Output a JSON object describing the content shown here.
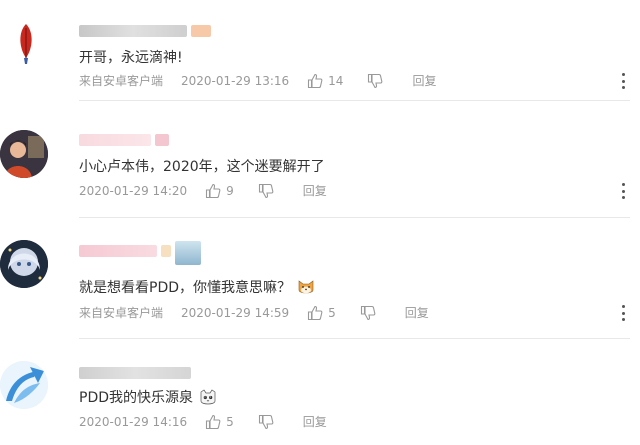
{
  "comments": [
    {
      "text": "开哥，永远滴神!",
      "source": "来自安卓客户端",
      "time": "2020-01-29 13:16",
      "likes": "14",
      "reply_label": "回复",
      "avatar": "red-feather-icon"
    },
    {
      "text": "小心卢本伟，2020年，这个迷要解开了",
      "source": "",
      "time": "2020-01-29 14:20",
      "likes": "9",
      "reply_label": "回复",
      "avatar": "person-photo"
    },
    {
      "text": "就是想看看PDD，你懂我意思嘛？",
      "source": "来自安卓客户端",
      "time": "2020-01-29 14:59",
      "likes": "5",
      "reply_label": "回复",
      "emoji": "shiba-dog-emoji",
      "avatar": "anime-girl-photo"
    },
    {
      "text": "PDD我的快乐源泉",
      "source": "",
      "time": "2020-01-29 14:16",
      "likes": "5",
      "reply_label": "回复",
      "emoji": "crying-cat-emoji",
      "avatar": "blue-arrow-logo"
    }
  ],
  "colors": {
    "meta": "#999999",
    "text": "#333333",
    "divider": "#e8e8e8"
  }
}
